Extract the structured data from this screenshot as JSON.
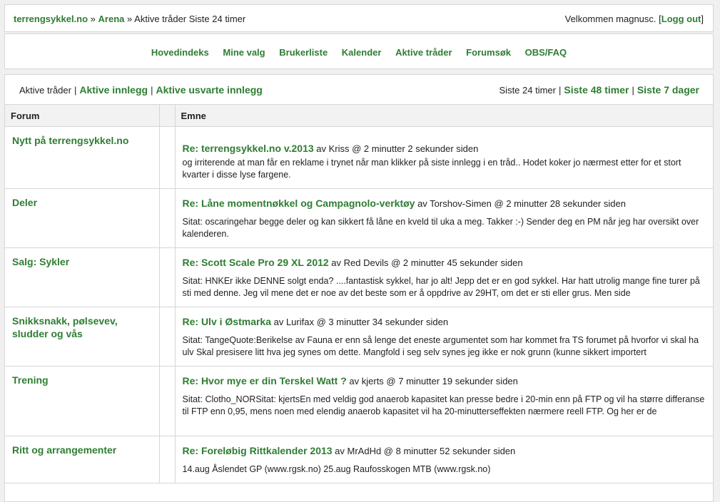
{
  "breadcrumb": {
    "site": "terrengsykkel.no",
    "sep1": "»",
    "arena": "Arena",
    "sep2": "»",
    "current": "Aktive tråder Siste 24 timer"
  },
  "user": {
    "welcome": "Velkommen magnusc.",
    "bracket_open": "[",
    "logout": "Logg out",
    "bracket_close": "]"
  },
  "nav": [
    "Hovedindeks",
    "Mine valg",
    "Brukerliste",
    "Kalender",
    "Aktive tråder",
    "Forumsøk",
    "OBS/FAQ"
  ],
  "filters": {
    "current": "Aktive tråder",
    "sep": "|",
    "link1": "Aktive innlegg",
    "link2": "Aktive usvarte innlegg"
  },
  "periods": {
    "current": "Siste 24 timer",
    "sep": "|",
    "link1": "Siste 48 timer",
    "link2": "Siste 7 dager"
  },
  "table": {
    "col_forum": "Forum",
    "col_subject": "Emne",
    "rows": [
      {
        "forum": "Nytt på terrengsykkel.no",
        "title": "Re: terrengsykkel.no v.2013",
        "meta": " av Kriss @ 2 minutter 2 sekunder siden",
        "excerpt": "og irriterende at man får en reklame i trynet når man klikker på siste innlegg i en tråd.. Hodet koker jo nærmest etter for et stort kvarter i disse lyse fargene."
      },
      {
        "forum": "Deler",
        "title": "Re: Låne momentnøkkel og Campagnolo-verktøy",
        "meta": " av Torshov-Simen @ 2 minutter 28 sekunder siden",
        "excerpt": "Sitat: oscaringehar begge deler og kan sikkert få låne en kveld til uka a meg. Takker :-) Sender deg en PM når jeg har oversikt over kalenderen."
      },
      {
        "forum": "Salg: Sykler",
        "title": "Re: Scott Scale Pro 29 XL 2012",
        "meta": " av Red Devils @ 2 minutter 45 sekunder siden",
        "excerpt": "Sitat: HNKEr ikke DENNE solgt enda? ....fantastisk sykkel, har jo alt! Jepp det er en god sykkel. Har hatt utrolig mange fine turer på sti med denne. Jeg vil mene det er noe av det beste som er å oppdrive av 29HT, om det er sti eller grus. Men side"
      },
      {
        "forum": "Snikksnakk, pølsevev, sludder og vås",
        "title": "Re: Ulv i Østmarka",
        "meta": " av Lurifax @ 3 minutter 34 sekunder siden",
        "excerpt": "Sitat: TangeQuote:Berikelse av Fauna er enn så lenge det eneste argumentet som har kommet fra TS forumet på hvorfor vi skal ha ulv Skal presisere litt hva jeg synes om dette. Mangfold i seg selv synes jeg ikke er nok grunn (kunne sikkert importert"
      },
      {
        "forum": "Trening",
        "title": "Re: Hvor mye er din Terskel Watt ?",
        "meta": " av kjerts @ 7 minutter 19 sekunder siden",
        "excerpt": "Sitat: Clotho_NORSitat: kjertsEn med veldig god anaerob kapasitet kan presse bedre i 20-min enn på FTP og vil ha større differanse til FTP enn 0,95, mens noen med elendig anaerob kapasitet vil ha 20-minutterseffekten nærmere reell FTP. Og her er de"
      },
      {
        "forum": "Ritt og arrangementer",
        "title": "Re: Foreløbig Rittkalender 2013",
        "meta": " av MrAdHd @ 8 minutter 52 sekunder siden",
        "excerpt": "14.aug Åslendet GP (www.rgsk.no) 25.aug Raufosskogen MTB (www.rgsk.no)"
      }
    ]
  },
  "colors": {
    "link": "#2e7d32",
    "border": "#d6d6d6",
    "header_bg": "#f2f2f2"
  }
}
